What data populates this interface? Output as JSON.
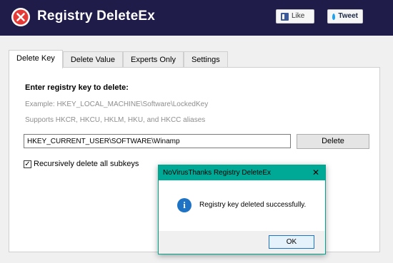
{
  "header": {
    "title": "Registry DeleteEx",
    "like_label": "Like",
    "tweet_label": "Tweet"
  },
  "tabs": [
    {
      "label": "Delete Key",
      "active": true
    },
    {
      "label": "Delete Value",
      "active": false
    },
    {
      "label": "Experts Only",
      "active": false
    },
    {
      "label": "Settings",
      "active": false
    }
  ],
  "delete_key": {
    "heading": "Enter registry key to delete:",
    "example": "Example: HKEY_LOCAL_MACHINE\\Software\\LockedKey",
    "aliases": "Supports HKCR, HKCU, HKLM, HKU, and HKCC aliases",
    "key_value": "HKEY_CURRENT_USER\\SOFTWARE\\Winamp",
    "delete_label": "Delete",
    "recursive_label": "Recursively delete all subkeys",
    "recursive_checked": true
  },
  "dialog": {
    "title": "NoVirusThanks Registry DeleteEx",
    "message": "Registry key deleted successfully.",
    "ok_label": "OK"
  },
  "colors": {
    "header_bg": "#1f1c4a",
    "dialog_accent": "#00a896",
    "info_blue": "#1e73c5"
  }
}
